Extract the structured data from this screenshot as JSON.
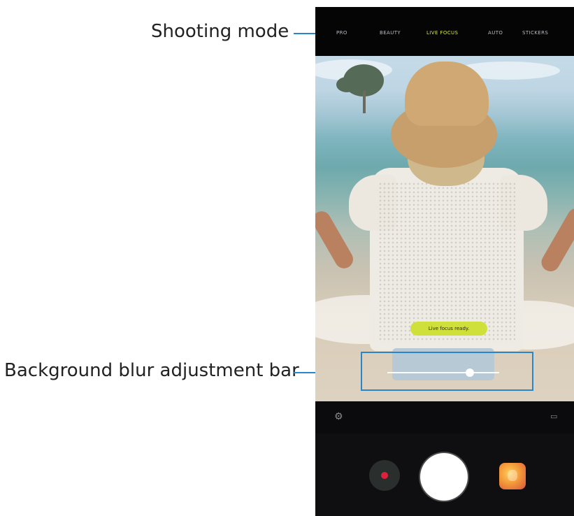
{
  "callouts": {
    "shooting_mode": "Shooting mode",
    "background_blur": "Background blur adjustment bar"
  },
  "camera": {
    "modes": [
      "PRO",
      "BEAUTY",
      "LIVE FOCUS",
      "AUTO",
      "STICKERS"
    ],
    "active_mode": "LIVE FOCUS",
    "status_message": "Live focus ready.",
    "background_blur_level": 0.74
  },
  "colors": {
    "callout_line": "#2a86c7",
    "active_mode": "#d7e54a",
    "status_pill": "#cfe03a",
    "record_dot": "#e0213c"
  },
  "icons": {
    "settings": "gear-icon",
    "ratio": "aspect-ratio-icon",
    "record": "record-icon",
    "gallery": "gallery-thumbnail"
  }
}
